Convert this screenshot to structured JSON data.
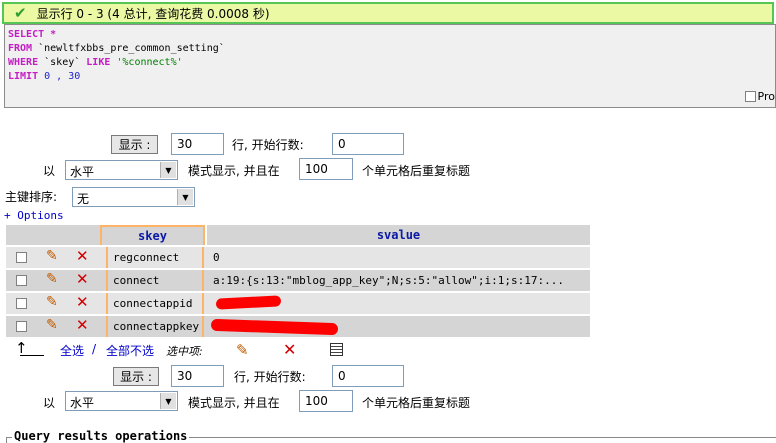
{
  "status": {
    "message": "显示行 0 - 3 (4 总计, 查询花费 0.0008 秒)"
  },
  "sql": {
    "select_kw": "SELECT",
    "select_rest": " *",
    "from_kw": "FROM",
    "from_table": " `newltfxbbs_pre_common_setting`",
    "where_kw": "WHERE",
    "where_col": " `skey` ",
    "like_kw": "LIKE",
    "like_val": " '%connect%'",
    "limit_kw": "LIMIT",
    "limit_val": " 0 , 30"
  },
  "profiling": {
    "label": "Pro"
  },
  "nav_top": {
    "show_button": "显示 :",
    "rows_value": "30",
    "start_label": "行, 开始行数:",
    "start_value": "0",
    "by_label": "以",
    "mode_value": "水平",
    "mode_label": "模式显示, 并且在",
    "repeat_value": "100",
    "repeat_label": "个单元格后重复标题"
  },
  "sort": {
    "label": "主键排序:",
    "value": "无"
  },
  "options": {
    "label": "+ Options"
  },
  "table": {
    "columns": [
      "skey",
      "svalue"
    ],
    "rows": [
      {
        "skey": "regconnect",
        "svalue": "0"
      },
      {
        "skey": "connect",
        "svalue": "a:19:{s:13:\"mblog_app_key\";N;s:5:\"allow\";i:1;s:17:..."
      },
      {
        "skey": "connectappid",
        "svalue": ""
      },
      {
        "skey": "connectappkey",
        "svalue": ""
      }
    ]
  },
  "bulk": {
    "arrow": "↑",
    "select_all": "全选",
    "separator": "/",
    "deselect_all": "全部不选",
    "selected_label": "选中项:"
  },
  "nav_bottom": {
    "show_button": "显示 :",
    "rows_value": "30",
    "start_label": "行, 开始行数:",
    "start_value": "0",
    "by_label": "以",
    "mode_value": "水平",
    "mode_label": "模式显示, 并且在",
    "repeat_value": "100",
    "repeat_label": "个单元格后重复标题"
  },
  "ops": {
    "legend": "Query results operations"
  },
  "colors": {
    "row_odd": "#e5e5e5",
    "row_even": "#d5d5d5",
    "header_text": "#0b19a4",
    "redaction": "#ff0000"
  }
}
